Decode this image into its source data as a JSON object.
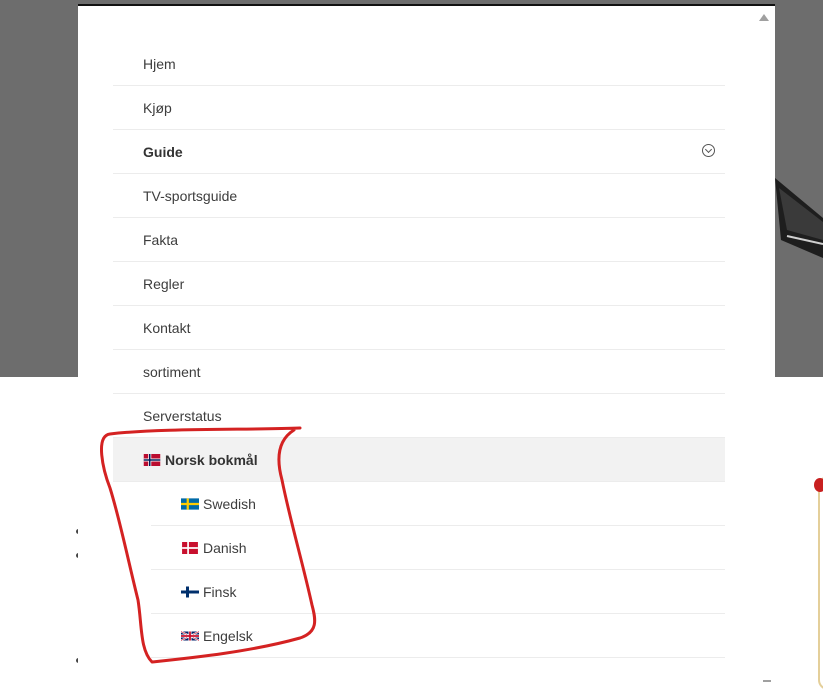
{
  "menu": {
    "items": [
      {
        "label": "Hjem"
      },
      {
        "label": "Kjøp"
      },
      {
        "label": "Guide"
      },
      {
        "label": "TV-sportsguide"
      },
      {
        "label": "Fakta"
      },
      {
        "label": "Regler"
      },
      {
        "label": "Kontakt"
      },
      {
        "label": "sortiment"
      },
      {
        "label": "Serverstatus"
      }
    ],
    "language": {
      "current": "Norsk bokmål",
      "options": [
        {
          "label": "Swedish",
          "flag": "flag-sweden-icon"
        },
        {
          "label": "Danish",
          "flag": "flag-denmark-icon"
        },
        {
          "label": "Finsk",
          "flag": "flag-finland-icon"
        },
        {
          "label": "Engelsk",
          "flag": "flag-uk-icon"
        }
      ],
      "current_flag": "flag-norway-icon"
    }
  },
  "icons": {
    "guide_toggle": "chevron-down-circle-icon"
  },
  "colors": {
    "annotation": "#d42222",
    "active_bg": "#f2f2f2",
    "backdrop": "#6d6d6d"
  }
}
